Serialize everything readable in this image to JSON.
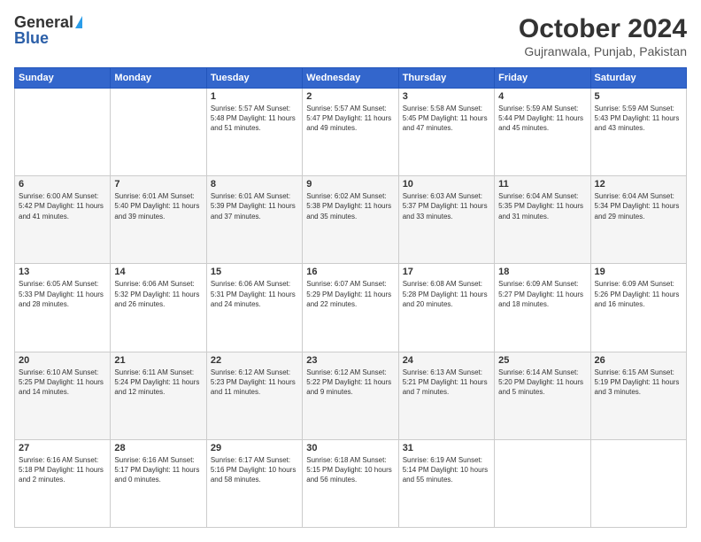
{
  "logo": {
    "general": "General",
    "blue": "Blue"
  },
  "header": {
    "title": "October 2024",
    "location": "Gujranwala, Punjab, Pakistan"
  },
  "days_of_week": [
    "Sunday",
    "Monday",
    "Tuesday",
    "Wednesday",
    "Thursday",
    "Friday",
    "Saturday"
  ],
  "weeks": [
    [
      {
        "day": null,
        "info": null
      },
      {
        "day": null,
        "info": null
      },
      {
        "day": "1",
        "info": "Sunrise: 5:57 AM\nSunset: 5:48 PM\nDaylight: 11 hours and 51 minutes."
      },
      {
        "day": "2",
        "info": "Sunrise: 5:57 AM\nSunset: 5:47 PM\nDaylight: 11 hours and 49 minutes."
      },
      {
        "day": "3",
        "info": "Sunrise: 5:58 AM\nSunset: 5:45 PM\nDaylight: 11 hours and 47 minutes."
      },
      {
        "day": "4",
        "info": "Sunrise: 5:59 AM\nSunset: 5:44 PM\nDaylight: 11 hours and 45 minutes."
      },
      {
        "day": "5",
        "info": "Sunrise: 5:59 AM\nSunset: 5:43 PM\nDaylight: 11 hours and 43 minutes."
      }
    ],
    [
      {
        "day": "6",
        "info": "Sunrise: 6:00 AM\nSunset: 5:42 PM\nDaylight: 11 hours and 41 minutes."
      },
      {
        "day": "7",
        "info": "Sunrise: 6:01 AM\nSunset: 5:40 PM\nDaylight: 11 hours and 39 minutes."
      },
      {
        "day": "8",
        "info": "Sunrise: 6:01 AM\nSunset: 5:39 PM\nDaylight: 11 hours and 37 minutes."
      },
      {
        "day": "9",
        "info": "Sunrise: 6:02 AM\nSunset: 5:38 PM\nDaylight: 11 hours and 35 minutes."
      },
      {
        "day": "10",
        "info": "Sunrise: 6:03 AM\nSunset: 5:37 PM\nDaylight: 11 hours and 33 minutes."
      },
      {
        "day": "11",
        "info": "Sunrise: 6:04 AM\nSunset: 5:35 PM\nDaylight: 11 hours and 31 minutes."
      },
      {
        "day": "12",
        "info": "Sunrise: 6:04 AM\nSunset: 5:34 PM\nDaylight: 11 hours and 29 minutes."
      }
    ],
    [
      {
        "day": "13",
        "info": "Sunrise: 6:05 AM\nSunset: 5:33 PM\nDaylight: 11 hours and 28 minutes."
      },
      {
        "day": "14",
        "info": "Sunrise: 6:06 AM\nSunset: 5:32 PM\nDaylight: 11 hours and 26 minutes."
      },
      {
        "day": "15",
        "info": "Sunrise: 6:06 AM\nSunset: 5:31 PM\nDaylight: 11 hours and 24 minutes."
      },
      {
        "day": "16",
        "info": "Sunrise: 6:07 AM\nSunset: 5:29 PM\nDaylight: 11 hours and 22 minutes."
      },
      {
        "day": "17",
        "info": "Sunrise: 6:08 AM\nSunset: 5:28 PM\nDaylight: 11 hours and 20 minutes."
      },
      {
        "day": "18",
        "info": "Sunrise: 6:09 AM\nSunset: 5:27 PM\nDaylight: 11 hours and 18 minutes."
      },
      {
        "day": "19",
        "info": "Sunrise: 6:09 AM\nSunset: 5:26 PM\nDaylight: 11 hours and 16 minutes."
      }
    ],
    [
      {
        "day": "20",
        "info": "Sunrise: 6:10 AM\nSunset: 5:25 PM\nDaylight: 11 hours and 14 minutes."
      },
      {
        "day": "21",
        "info": "Sunrise: 6:11 AM\nSunset: 5:24 PM\nDaylight: 11 hours and 12 minutes."
      },
      {
        "day": "22",
        "info": "Sunrise: 6:12 AM\nSunset: 5:23 PM\nDaylight: 11 hours and 11 minutes."
      },
      {
        "day": "23",
        "info": "Sunrise: 6:12 AM\nSunset: 5:22 PM\nDaylight: 11 hours and 9 minutes."
      },
      {
        "day": "24",
        "info": "Sunrise: 6:13 AM\nSunset: 5:21 PM\nDaylight: 11 hours and 7 minutes."
      },
      {
        "day": "25",
        "info": "Sunrise: 6:14 AM\nSunset: 5:20 PM\nDaylight: 11 hours and 5 minutes."
      },
      {
        "day": "26",
        "info": "Sunrise: 6:15 AM\nSunset: 5:19 PM\nDaylight: 11 hours and 3 minutes."
      }
    ],
    [
      {
        "day": "27",
        "info": "Sunrise: 6:16 AM\nSunset: 5:18 PM\nDaylight: 11 hours and 2 minutes."
      },
      {
        "day": "28",
        "info": "Sunrise: 6:16 AM\nSunset: 5:17 PM\nDaylight: 11 hours and 0 minutes."
      },
      {
        "day": "29",
        "info": "Sunrise: 6:17 AM\nSunset: 5:16 PM\nDaylight: 10 hours and 58 minutes."
      },
      {
        "day": "30",
        "info": "Sunrise: 6:18 AM\nSunset: 5:15 PM\nDaylight: 10 hours and 56 minutes."
      },
      {
        "day": "31",
        "info": "Sunrise: 6:19 AM\nSunset: 5:14 PM\nDaylight: 10 hours and 55 minutes."
      },
      {
        "day": null,
        "info": null
      },
      {
        "day": null,
        "info": null
      }
    ]
  ]
}
